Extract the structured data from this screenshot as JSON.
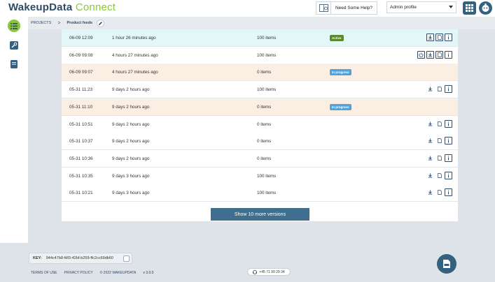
{
  "app": {
    "brand_main": "WakeupData",
    "brand_sub": "Connect"
  },
  "header": {
    "help_label": "Need Some Help?",
    "profile_selected": "Admin profile"
  },
  "breadcrumb": {
    "root": "PROJECTS",
    "separator": ">",
    "current": "Product feeds"
  },
  "versions": [
    {
      "date": "06-09 12:09",
      "ago": "1 hour 26 minutes ago",
      "items": "100 items",
      "status": "Active",
      "status_type": "active",
      "bg": "#e3f6f8",
      "actions": [
        "download",
        "document",
        "info"
      ],
      "action_style": "bordered"
    },
    {
      "date": "06-09 09:08",
      "ago": "4 hours 27 minutes ago",
      "items": "100 items",
      "status": "",
      "status_type": "",
      "bg": "#ffffff",
      "actions": [
        "power",
        "download",
        "document",
        "info"
      ],
      "action_style": "bordered"
    },
    {
      "date": "06-09 09:07",
      "ago": "4 hours 27 minutes ago",
      "items": "0 items",
      "status": "In progress",
      "status_type": "progress",
      "bg": "#fbeee2",
      "actions": [],
      "action_style": "plain"
    },
    {
      "date": "05-31 11:23",
      "ago": "9 days 2 hours ago",
      "items": "100 items",
      "status": "",
      "status_type": "",
      "bg": "#ffffff",
      "actions": [
        "download",
        "document",
        "info"
      ],
      "action_style": "plain"
    },
    {
      "date": "05-31 11:10",
      "ago": "9 days 2 hours ago",
      "items": "0 items",
      "status": "In progress",
      "status_type": "progress",
      "bg": "#fbeee2",
      "actions": [],
      "action_style": "plain"
    },
    {
      "date": "05-31 10:51",
      "ago": "9 days 2 hours ago",
      "items": "0 items",
      "status": "",
      "status_type": "",
      "bg": "#ffffff",
      "actions": [
        "download",
        "document",
        "info"
      ],
      "action_style": "plain"
    },
    {
      "date": "05-31 10:37",
      "ago": "9 days 2 hours ago",
      "items": "0 items",
      "status": "",
      "status_type": "",
      "bg": "#ffffff",
      "actions": [
        "download",
        "document",
        "info"
      ],
      "action_style": "plain"
    },
    {
      "date": "05-31 10:36",
      "ago": "9 days 2 hours ago",
      "items": "0 items",
      "status": "",
      "status_type": "",
      "bg": "#ffffff",
      "actions": [
        "download",
        "document",
        "info"
      ],
      "action_style": "plain"
    },
    {
      "date": "05-31 10:35",
      "ago": "9 days 3 hours ago",
      "items": "100 items",
      "status": "",
      "status_type": "",
      "bg": "#ffffff",
      "actions": [
        "download",
        "document",
        "info"
      ],
      "action_style": "plain"
    },
    {
      "date": "05-31 10:21",
      "ago": "9 days 3 hours ago",
      "items": "100 items",
      "status": "",
      "status_type": "",
      "bg": "#ffffff",
      "actions": [
        "download",
        "document",
        "info"
      ],
      "action_style": "plain"
    }
  ],
  "show_more_label": "Show 10 more versions",
  "footer": {
    "key_label": "KEY:",
    "key_value": "944c47b8-fdf3-42bf-b259-ffc2cc69db60",
    "terms": "TERMS OF USE",
    "privacy": "PRIVACY POLICY",
    "copyright": "© 2022 WAKEUPDATA",
    "version": "v 3.0.0",
    "phone": "+45 71 99 29 34"
  },
  "colors": {
    "brand": "#2e4a66",
    "accent": "#8cc63f",
    "primary": "#3f6e8e",
    "active": "#5b8a2b",
    "progress": "#4fa3e0"
  }
}
